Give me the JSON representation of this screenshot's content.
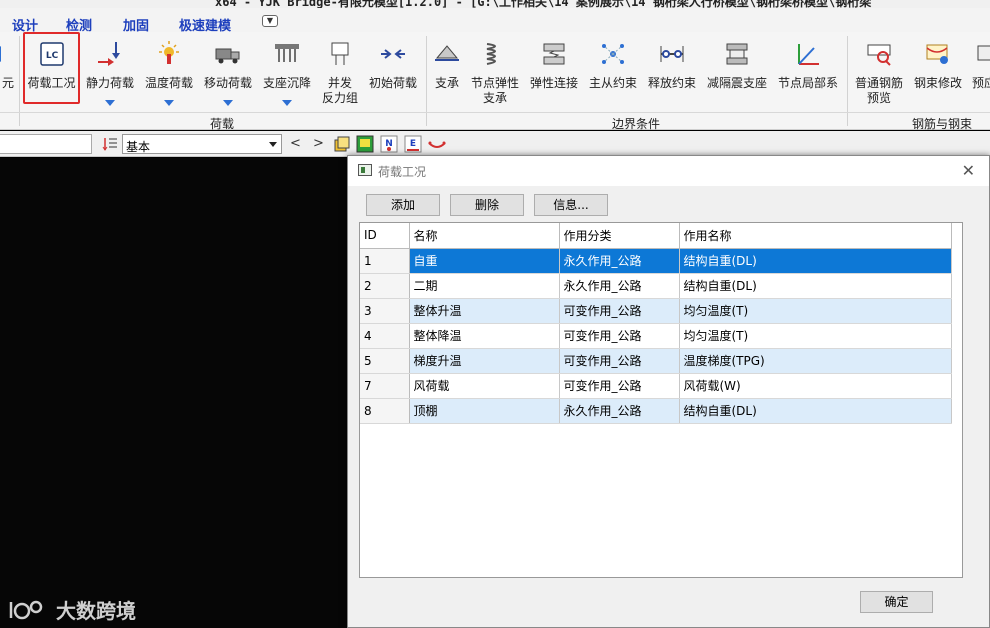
{
  "window": {
    "title": "x64 - YJK Bridge-有限元模型[1.2.0] - [G:\\工作相关\\14 案例展示\\14 钢桁梁人行桥模型\\钢桁梁桥模型\\钢桁梁"
  },
  "menu": {
    "items": [
      "设计",
      "检测",
      "加固",
      "极速建模"
    ],
    "dropdown_icon": "chevron-down-icon"
  },
  "ribbon": {
    "partial_left_label": "元",
    "load_buttons": [
      {
        "label": "荷载工况",
        "icon": "lc-icon"
      },
      {
        "label": "静力荷载",
        "icon": "static-load-icon"
      },
      {
        "label": "温度荷载",
        "icon": "temperature-load-icon"
      },
      {
        "label": "移动荷载",
        "icon": "moving-load-icon"
      },
      {
        "label": "支座沉降",
        "icon": "support-settlement-icon"
      },
      {
        "label": "并发\n反力组",
        "icon": "concurrent-reaction-icon"
      },
      {
        "label": "初始荷载",
        "icon": "initial-load-icon"
      }
    ],
    "boundary_buttons": [
      {
        "label": "支承",
        "icon": "support-icon"
      },
      {
        "label": "节点弹性\n支承",
        "icon": "spring-icon"
      },
      {
        "label": "弹性连接",
        "icon": "elastic-link-icon"
      },
      {
        "label": "主从约束",
        "icon": "master-slave-icon"
      },
      {
        "label": "释放约束",
        "icon": "release-icon"
      },
      {
        "label": "减隔震支座",
        "icon": "isolation-bearing-icon"
      },
      {
        "label": "节点局部系",
        "icon": "local-axis-icon"
      }
    ],
    "rebar_buttons": [
      {
        "label": "普通钢筋\n预览",
        "icon": "rebar-preview-icon"
      },
      {
        "label": "钢束修改",
        "icon": "tendon-edit-icon"
      },
      {
        "label": "预应",
        "icon": "prestress-icon"
      }
    ],
    "group_labels": {
      "load": "荷载",
      "boundary": "边界条件",
      "rebar": "钢筋与钢束"
    }
  },
  "toolbar2": {
    "combo_value": "基本",
    "prev": "<",
    "next": ">"
  },
  "dialog": {
    "title": "荷载工况",
    "buttons": {
      "add": "添加",
      "delete": "删除",
      "info": "信息..."
    },
    "table": {
      "columns": [
        "ID",
        "名称",
        "作用分类",
        "作用名称"
      ],
      "rows": [
        {
          "id": "1",
          "name": "自重",
          "category": "永久作用_公路",
          "action": "结构自重(DL)",
          "selected": true
        },
        {
          "id": "2",
          "name": "二期",
          "category": "永久作用_公路",
          "action": "结构自重(DL)"
        },
        {
          "id": "3",
          "name": "整体升温",
          "category": "可变作用_公路",
          "action": "均匀温度(T)"
        },
        {
          "id": "4",
          "name": "整体降温",
          "category": "可变作用_公路",
          "action": "均匀温度(T)"
        },
        {
          "id": "5",
          "name": "梯度升温",
          "category": "可变作用_公路",
          "action": "温度梯度(TPG)"
        },
        {
          "id": "7",
          "name": "风荷载",
          "category": "可变作用_公路",
          "action": "风荷载(W)"
        },
        {
          "id": "8",
          "name": "顶棚",
          "category": "永久作用_公路",
          "action": "结构自重(DL)"
        }
      ]
    },
    "ok": "确定"
  },
  "watermark": {
    "text": "大数跨境"
  },
  "colors": {
    "selection": "#0d78d6",
    "alt_row": "#dcecfa",
    "highlight_box": "#e02a2a",
    "menu_text": "#1d3fbd"
  }
}
